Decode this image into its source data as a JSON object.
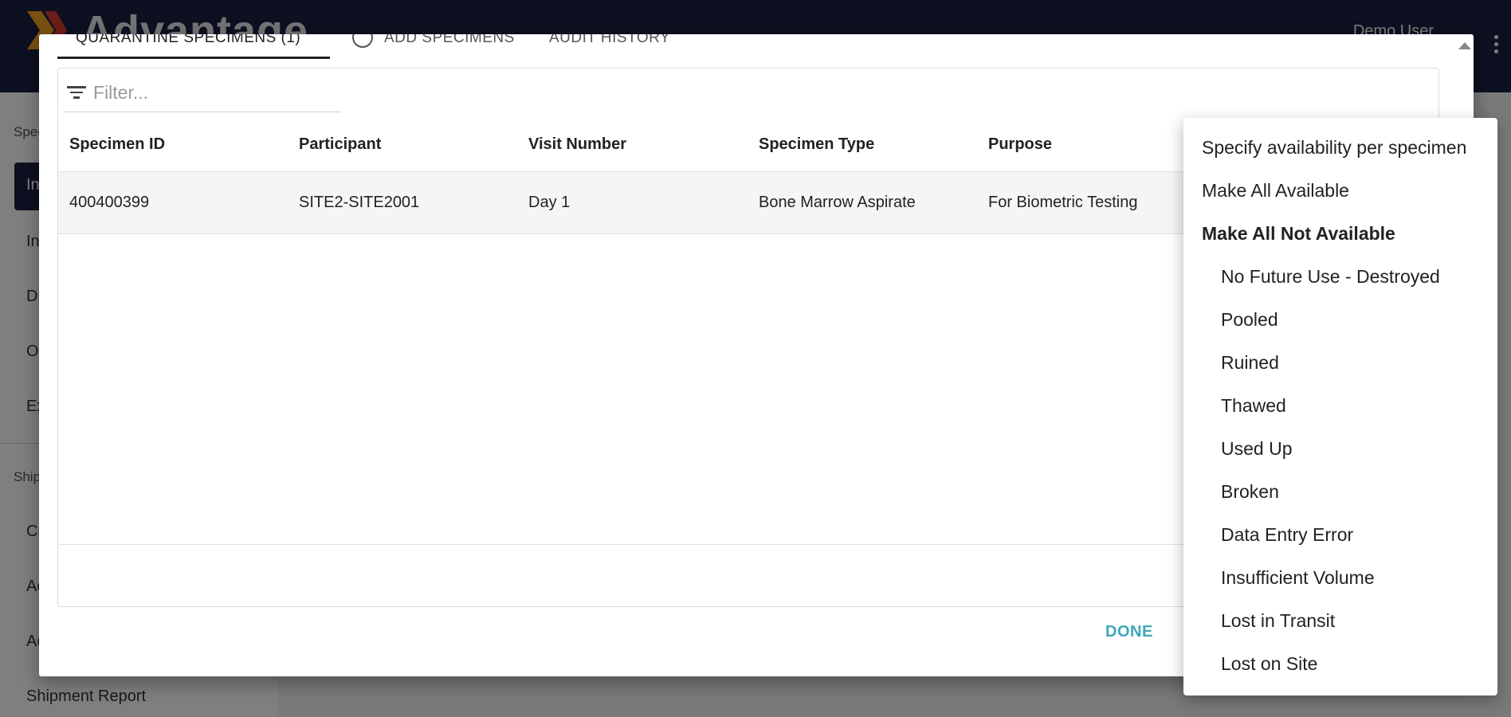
{
  "app": {
    "title": "Advantage",
    "user": "Demo User"
  },
  "sidebar": {
    "sections": [
      "Spec",
      "Ship"
    ],
    "items": [
      "In",
      "In",
      "Di",
      "O",
      "Ex",
      "Cr",
      "Ac",
      "Ac",
      "Shipment Report"
    ]
  },
  "dialog": {
    "tabs": [
      "QUARANTINE SPECIMENS (1)",
      "ADD SPECIMENS",
      "AUDIT HISTORY"
    ],
    "filter_placeholder": "Filter...",
    "table": {
      "columns": [
        "Specimen ID",
        "Participant",
        "Visit Number",
        "Specimen Type",
        "Purpose"
      ],
      "rows": [
        [
          "400400399",
          "SITE2-SITE2001",
          "Day 1",
          "Bone Marrow Aspirate",
          "For Biometric Testing"
        ]
      ]
    },
    "done_label": "DONE"
  },
  "menu": {
    "items": [
      "Specify availability per specimen",
      "Make All Available",
      "Make All Not Available",
      "No Future Use - Destroyed",
      "Pooled",
      "Ruined",
      "Thawed",
      "Used Up",
      "Broken",
      "Data Entry Error",
      "Insufficient Volume",
      "Lost in Transit",
      "Lost on Site"
    ]
  },
  "colors": {
    "topbar": "#1b2140",
    "accent": "#3ea8b8",
    "logo_orange": "#f0a020",
    "logo_red": "#d63a2f"
  }
}
